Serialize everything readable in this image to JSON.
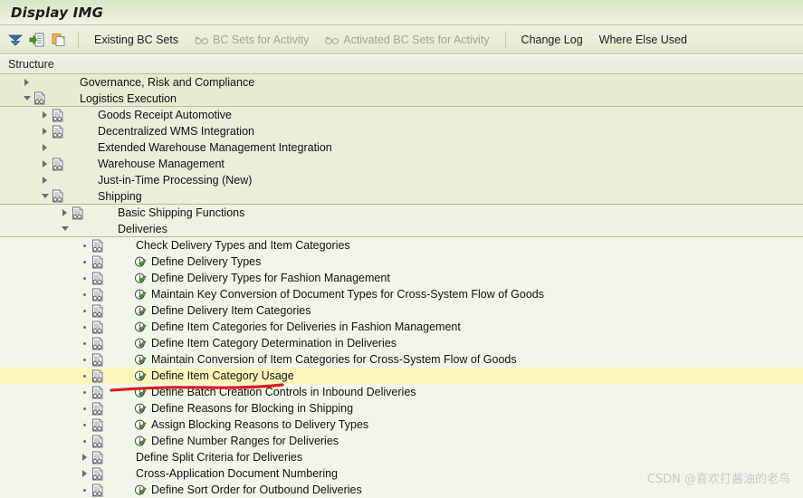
{
  "window": {
    "title": "Display IMG"
  },
  "toolbar": {
    "icons": [
      {
        "name": "expand-collapse-icon",
        "glyph": "filter-triangle"
      },
      {
        "name": "execute-document-icon",
        "glyph": "doc-green-arrow"
      },
      {
        "name": "copy-icon",
        "glyph": "copy-orange"
      }
    ],
    "buttons": [
      {
        "label": "Existing BC Sets",
        "disabled": false,
        "icon": ""
      },
      {
        "label": "BC Sets for Activity",
        "disabled": true,
        "icon": "glasses-icon"
      },
      {
        "label": "Activated BC Sets for Activity",
        "disabled": true,
        "icon": "glasses-icon"
      },
      {
        "label": "Change Log",
        "disabled": false,
        "icon": ""
      },
      {
        "label": "Where Else Used",
        "disabled": false,
        "icon": ""
      }
    ]
  },
  "structure": {
    "header": "Structure",
    "rows": [
      {
        "label": "Governance, Risk and Compliance",
        "depth": 0,
        "marker": "collapsed",
        "doc": false,
        "action": false,
        "separator": false,
        "highlight": false
      },
      {
        "label": "Logistics Execution",
        "depth": 0,
        "marker": "expanded",
        "doc": true,
        "action": false,
        "separator": true,
        "highlight": false
      },
      {
        "label": "Goods Receipt Automotive",
        "depth": 1,
        "marker": "collapsed",
        "doc": true,
        "action": false,
        "separator": false,
        "highlight": false
      },
      {
        "label": "Decentralized WMS Integration",
        "depth": 1,
        "marker": "collapsed",
        "doc": true,
        "action": false,
        "separator": false,
        "highlight": false
      },
      {
        "label": "Extended Warehouse Management Integration",
        "depth": 1,
        "marker": "collapsed",
        "doc": false,
        "action": false,
        "separator": false,
        "highlight": false
      },
      {
        "label": "Warehouse Management",
        "depth": 1,
        "marker": "collapsed",
        "doc": true,
        "action": false,
        "separator": false,
        "highlight": false
      },
      {
        "label": "Just-in-Time Processing (New)",
        "depth": 1,
        "marker": "collapsed",
        "doc": false,
        "action": false,
        "separator": false,
        "highlight": false
      },
      {
        "label": "Shipping",
        "depth": 1,
        "marker": "expanded",
        "doc": true,
        "action": false,
        "separator": true,
        "highlight": false
      },
      {
        "label": "Basic Shipping Functions",
        "depth": 2,
        "marker": "collapsed",
        "doc": true,
        "action": false,
        "separator": false,
        "highlight": false
      },
      {
        "label": "Deliveries",
        "depth": 2,
        "marker": "expanded",
        "doc": false,
        "action": false,
        "separator": true,
        "highlight": false
      },
      {
        "label": "Check Delivery Types and Item Categories",
        "depth": 3,
        "marker": "leaf",
        "doc": true,
        "action": false,
        "separator": false,
        "highlight": false
      },
      {
        "label": "Define Delivery Types",
        "depth": 3,
        "marker": "leaf",
        "doc": true,
        "action": true,
        "separator": false,
        "highlight": false
      },
      {
        "label": "Define Delivery Types for Fashion Management",
        "depth": 3,
        "marker": "leaf",
        "doc": true,
        "action": true,
        "separator": false,
        "highlight": false
      },
      {
        "label": "Maintain Key Conversion of Document Types for Cross-System Flow of Goods",
        "depth": 3,
        "marker": "leaf",
        "doc": true,
        "action": true,
        "separator": false,
        "highlight": false
      },
      {
        "label": "Define Delivery Item Categories",
        "depth": 3,
        "marker": "leaf",
        "doc": true,
        "action": true,
        "separator": false,
        "highlight": false
      },
      {
        "label": "Define Item Categories for Deliveries in Fashion Management",
        "depth": 3,
        "marker": "leaf",
        "doc": true,
        "action": true,
        "separator": false,
        "highlight": false
      },
      {
        "label": "Define Item Category Determination in Deliveries",
        "depth": 3,
        "marker": "leaf",
        "doc": true,
        "action": true,
        "separator": false,
        "highlight": false
      },
      {
        "label": "Maintain Conversion of Item Categories for Cross-System Flow of Goods",
        "depth": 3,
        "marker": "leaf",
        "doc": true,
        "action": true,
        "separator": false,
        "highlight": false
      },
      {
        "label": "Define Item Category Usage",
        "depth": 3,
        "marker": "leaf",
        "doc": true,
        "action": true,
        "separator": false,
        "highlight": true
      },
      {
        "label": "Define Batch Creation Controls in Inbound Deliveries",
        "depth": 3,
        "marker": "leaf",
        "doc": true,
        "action": true,
        "separator": false,
        "highlight": false
      },
      {
        "label": "Define Reasons for Blocking in Shipping",
        "depth": 3,
        "marker": "leaf",
        "doc": true,
        "action": true,
        "separator": false,
        "highlight": false
      },
      {
        "label": "Assign Blocking Reasons to Delivery Types",
        "depth": 3,
        "marker": "leaf",
        "doc": true,
        "action": true,
        "separator": false,
        "highlight": false
      },
      {
        "label": "Define Number Ranges for Deliveries",
        "depth": 3,
        "marker": "leaf",
        "doc": true,
        "action": true,
        "separator": false,
        "highlight": false
      },
      {
        "label": "Define Split Criteria for Deliveries",
        "depth": 3,
        "marker": "collapsed",
        "doc": true,
        "action": false,
        "separator": false,
        "highlight": false
      },
      {
        "label": "Cross-Application Document Numbering",
        "depth": 3,
        "marker": "collapsed",
        "doc": true,
        "action": false,
        "separator": false,
        "highlight": false
      },
      {
        "label": "Define Sort Order for Outbound Deliveries",
        "depth": 3,
        "marker": "leaf",
        "doc": true,
        "action": true,
        "separator": false,
        "highlight": false
      }
    ]
  },
  "annotation": {
    "type": "red-underline",
    "target_row_label": "Define Item Category Usage",
    "color": "#e01b1b"
  },
  "watermark": {
    "text": "CSDN @喜欢打酱油的老鸟"
  }
}
